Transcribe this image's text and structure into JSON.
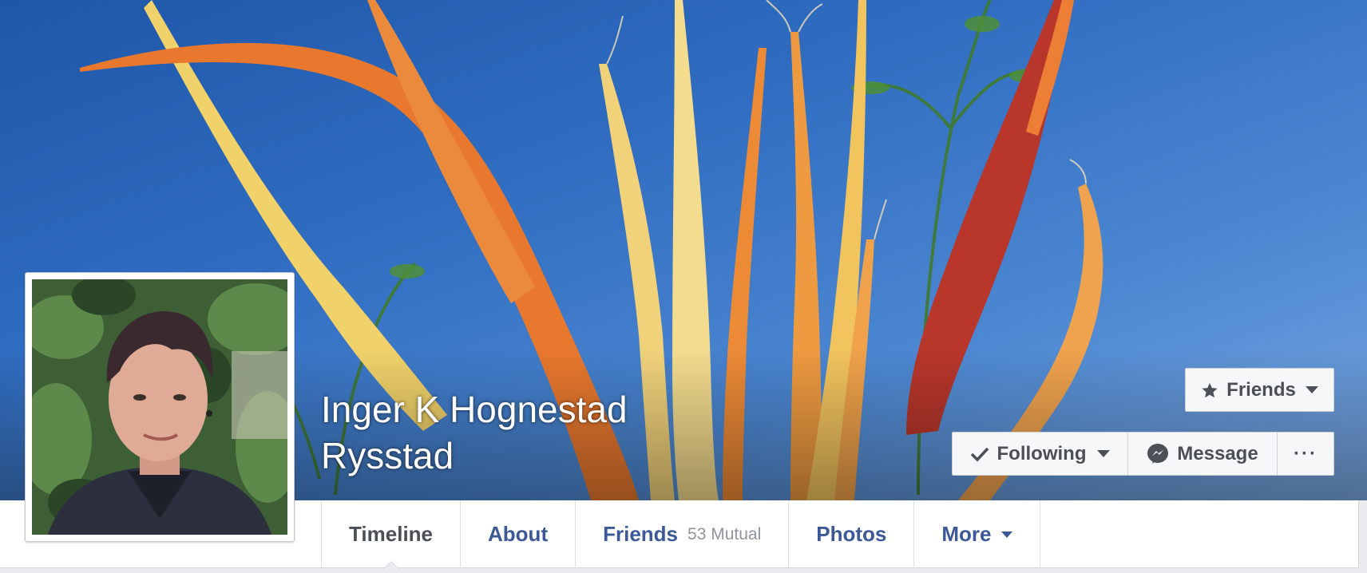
{
  "profile": {
    "name_line1": "Inger K Hognestad",
    "name_line2": "Rysstad"
  },
  "actions": {
    "friends_label": "Friends",
    "following_label": "Following",
    "message_label": "Message",
    "more_label": "···"
  },
  "tabs": [
    {
      "label": "Timeline",
      "active": true
    },
    {
      "label": "About"
    },
    {
      "label": "Friends",
      "badge": "53 Mutual"
    },
    {
      "label": "Photos"
    },
    {
      "label": "More"
    }
  ],
  "icons": {
    "friends": "star-icon",
    "following": "checkmark-icon",
    "message": "messenger-icon",
    "more": "ellipsis-icon",
    "dropdown": "caret-down-icon"
  },
  "colors": {
    "link": "#3b5998",
    "active_tab": "#4b4f56",
    "muted": "#90949c",
    "button_bg": "#f6f7f9",
    "button_border": "#ced0d4"
  }
}
